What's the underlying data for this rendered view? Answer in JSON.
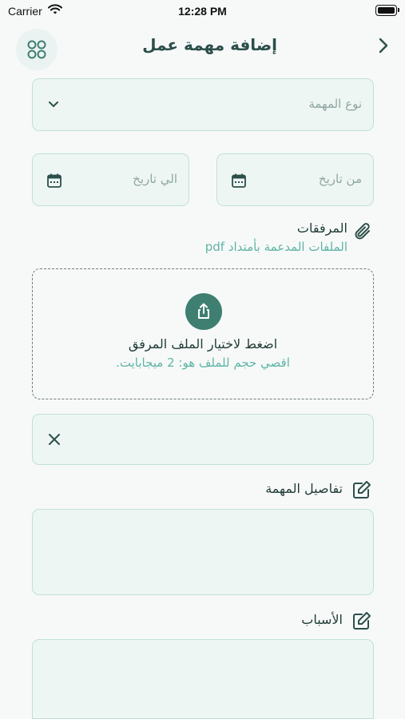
{
  "status_bar": {
    "carrier": "Carrier",
    "time": "12:28 PM"
  },
  "header": {
    "title": "إضافة مهمة عمل",
    "menu_icon": "grid-icon",
    "back_icon": "chevron-right-icon"
  },
  "task_type": {
    "placeholder": "نوع المهمة",
    "icon": "chevron-down-icon"
  },
  "dates": {
    "from_placeholder": "من تاريخ",
    "to_placeholder": "الي تاريخ",
    "icon": "calendar-icon"
  },
  "attachments": {
    "title": "المرفقات",
    "supported_formats": "الملفات المدعمة بأمتداد pdf",
    "icon": "paperclip-icon",
    "upload_prompt": "اضغط لاختيار الملف المرفق",
    "max_size": "اقصي حجم للملف هو: 2 ميجابايت.",
    "upload_icon": "share-upload-icon",
    "selected_file": "",
    "remove_icon": "close-icon"
  },
  "task_details": {
    "title": "تفاصيل المهمة",
    "value": "",
    "icon": "edit-icon"
  },
  "reasons": {
    "title": "الأسباب",
    "value": "",
    "icon": "edit-icon"
  },
  "colors": {
    "primary": "#3e7f72",
    "accent_text": "#5fb4a6",
    "field_bg": "#eef6f3",
    "field_border": "#bfe0da"
  }
}
